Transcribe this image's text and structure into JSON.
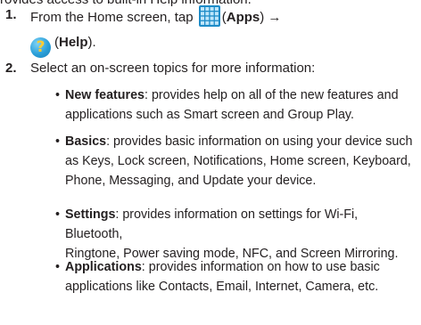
{
  "top_fragment": "rovides access to built-in Help information.",
  "step1": {
    "number": "1.",
    "text_before": "From the Home screen, tap",
    "apps_label": "Apps",
    "arrow": "→",
    "help_label": "Help",
    "apps_icon": "apps-grid-icon",
    "help_icon": "help-question-icon"
  },
  "step2": {
    "number": "2.",
    "text": "Select an on-screen topics for more information:"
  },
  "bullets": [
    {
      "term": "New features",
      "line1": ": provides help on all of the new features and",
      "line2": "applications such as Smart screen and Group Play."
    },
    {
      "term": "Basics",
      "line1": ": provides basic information on using your device such",
      "line2": "as Keys, Lock screen, Notifications, Home screen, Keyboard,",
      "line3": "Phone, Messaging, and Update your device."
    },
    {
      "term": "Settings",
      "line1": ": provides information on settings for Wi-Fi, Bluetooth,",
      "line2": "Ringtone, Power saving mode, NFC, and Screen Mirroring."
    },
    {
      "term": "Applications",
      "line1": ": provides information on how to use basic",
      "line2": "applications like Contacts, Email, Internet, Camera, etc."
    }
  ],
  "colors": {
    "text": "#231f20",
    "apps_icon": "#1e8cc8",
    "help_icon": "#2a9fd8"
  }
}
